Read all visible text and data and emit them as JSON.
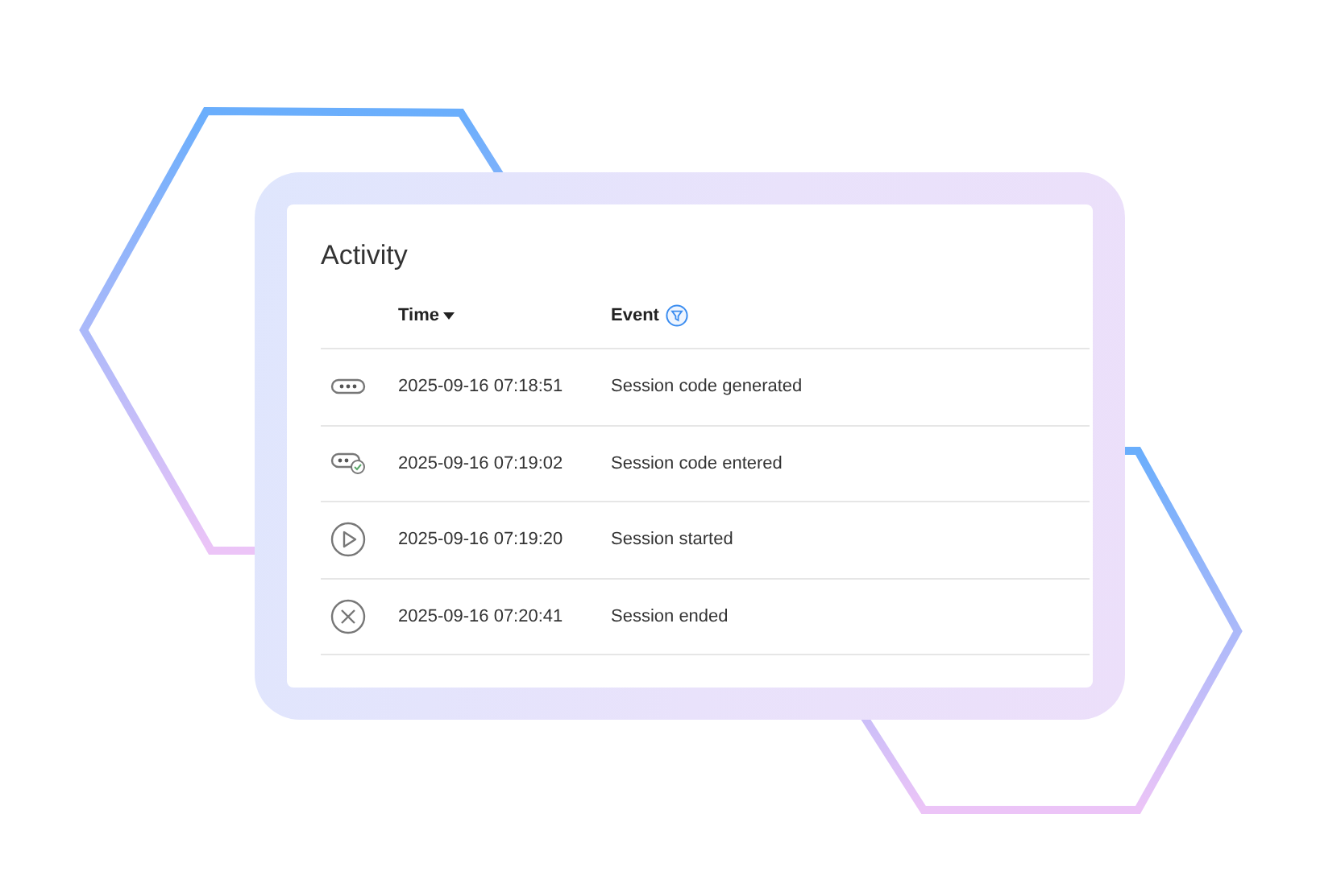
{
  "panel": {
    "title": "Activity"
  },
  "table": {
    "columns": [
      {
        "label": "Time",
        "sorted": true,
        "filter": false
      },
      {
        "label": "Event",
        "sorted": false,
        "filter": true
      }
    ],
    "rows": [
      {
        "kind": "code",
        "time": "2025-09-16 07:18:51",
        "event": "Session code generated"
      },
      {
        "kind": "code-entered",
        "time": "2025-09-16 07:19:02",
        "event": "Session code entered"
      },
      {
        "kind": "play",
        "time": "2025-09-16 07:19:20",
        "event": "Session started"
      },
      {
        "kind": "end",
        "time": "2025-09-16 07:20:41",
        "event": "Session ended"
      }
    ]
  }
}
